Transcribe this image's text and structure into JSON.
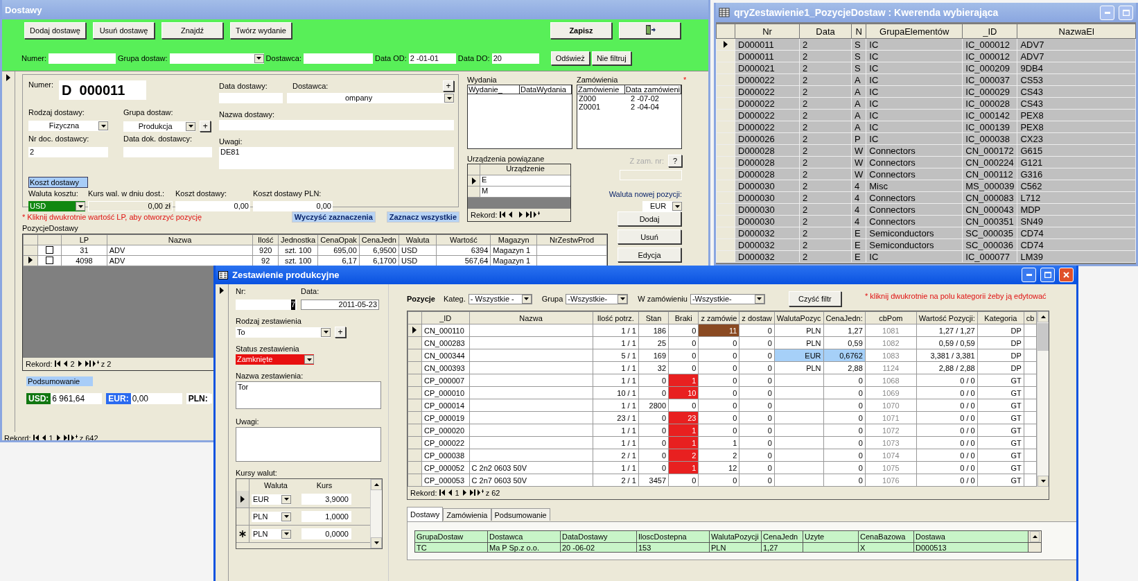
{
  "dostawy": {
    "title": "Dostawy",
    "toolbar": [
      "Dodaj dostawę",
      "Usuń dostawę",
      "Znajdź",
      "Twórz wydanie"
    ],
    "save": "Zapisz",
    "filter": {
      "numer_label": "Numer:",
      "grupa_label": "Grupa dostaw:",
      "dostawca_label": "Dostawca:",
      "od_label": "Data OD:",
      "od_value": "2 -01-01",
      "do_label": "Data DO:",
      "do_value": "20",
      "refresh": "Odśwież",
      "nofilter": "Nie filtruj"
    },
    "form": {
      "numer_label": "Numer:",
      "numer": "D  000011",
      "data_label": "Data dostawy:",
      "dostawca_label": "Dostawca:",
      "dostawca": "ompany",
      "plus": "+",
      "rodzaj_label": "Rodzaj dostawy:",
      "rodzaj": "Fizyczna",
      "grupa_label": "Grupa dostaw:",
      "grupa": "Produkcja",
      "grupa_plus": "+",
      "nazwa_label": "Nazwa dostawy:",
      "nrdoc_label": "Nr doc. dostawcy:",
      "nrdoc": "2",
      "datadok_label": "Data dok. dostawcy:",
      "uwagi_label": "Uwagi:",
      "uwagi": "DE81",
      "koszt_header": "Koszt dostawy",
      "waluta_label": "Waluta kosztu:",
      "waluta": "USD",
      "kurs_label": "Kurs wal. w dniu dost.:",
      "kurs": "0,00 zł",
      "koszt_label": "Koszt dostawy:",
      "koszt": "0,00",
      "kosztpln_label": "Koszt dostawy PLN:",
      "kosztpln": "0,00"
    },
    "note": "* Kliknij dwukrotnie wartość LP, aby otworzyć pozycję",
    "subform_label": "PozycjeDostawy",
    "clear_button": "Wyczyść zaznaczenia",
    "all_button": "Zaznacz wszystkie",
    "positions": {
      "columns": [
        "LP",
        "Nazwa",
        "Ilość",
        "Jednostka",
        "CenaOpak",
        "CenaJedn",
        "Waluta",
        "Wartość",
        "Magazyn",
        "NrZestwProd"
      ],
      "rows": [
        {
          "selected": false,
          "checked": false,
          "cells": [
            "31",
            "ADV",
            "920",
            "szt. 100",
            "695,00",
            "6,9500",
            "USD",
            "6394",
            "Magazyn 1"
          ]
        },
        {
          "selected": true,
          "checked": false,
          "cells": [
            "4098",
            "ADV",
            "92",
            "szt. 100",
            "6,17",
            "6,1700",
            "USD",
            "567,64",
            "Magazyn 1"
          ]
        }
      ],
      "nav": {
        "label": "Rekord:",
        "value": "2",
        "total": "z  2"
      }
    },
    "summary": {
      "header": "Podsumowanie",
      "usd_label": "USD:",
      "usd": "6 961,64",
      "eur_label": "EUR:",
      "eur": "0,00",
      "pln_label": "PLN:"
    },
    "wydania": {
      "title": "Wydania",
      "columns": [
        "Wydanie_",
        "DataWydania"
      ]
    },
    "zamowienia": {
      "title": "Zamówienia",
      "columns": [
        "Zamówienie",
        "Data zamówieni"
      ],
      "rows": [
        [
          "Z000",
          "2 -07-02"
        ],
        [
          "Z0001",
          "2 -04-04"
        ]
      ],
      "asterisk": "*"
    },
    "urzadzenia": {
      "title": "Urządzenia powiązane",
      "column": "Urządzenie",
      "rows": [
        {
          "text": "E",
          "selected": true
        },
        {
          "text": "M",
          "selected": false
        }
      ],
      "nav": {
        "label": "Rekord:"
      }
    },
    "zzam_label": "Z zam. nr:",
    "help_button": "?",
    "waluta_label": "Waluta nowej pozycji:",
    "waluta": "EUR",
    "buttons": [
      "Dodaj",
      "Usuń",
      "Edycja"
    ],
    "nav": {
      "label": "Rekord:",
      "value": "1",
      "total": "z  642"
    }
  },
  "query": {
    "title": "qryZestawienie1_PozycjeDostaw : Kwerenda wybierająca",
    "columns": [
      "Nr",
      "Data",
      "N",
      "GrupaElementów",
      "_ID",
      "NazwaEl"
    ],
    "rows": [
      {
        "selected": true,
        "cells": [
          "D000011",
          "2",
          "S",
          "IC",
          "IC_000012",
          "ADV7"
        ]
      },
      {
        "selected": false,
        "cells": [
          "D000011",
          "2",
          "S",
          "IC",
          "IC_000012",
          "ADV7"
        ]
      },
      {
        "selected": false,
        "cells": [
          "D000021",
          "2",
          "S",
          "IC",
          "IC_000209",
          "9DB4"
        ]
      },
      {
        "selected": false,
        "cells": [
          "D000022",
          "2",
          "A",
          "IC",
          "IC_000037",
          "CS53"
        ]
      },
      {
        "selected": false,
        "cells": [
          "D000022",
          "2",
          "A",
          "IC",
          "IC_000029",
          "CS43"
        ]
      },
      {
        "selected": false,
        "cells": [
          "D000022",
          "2",
          "A",
          "IC",
          "IC_000028",
          "CS43"
        ]
      },
      {
        "selected": false,
        "cells": [
          "D000022",
          "2",
          "A",
          "IC",
          "IC_000142",
          "PEX8"
        ]
      },
      {
        "selected": false,
        "cells": [
          "D000022",
          "2",
          "A",
          "IC",
          "IC_000139",
          "PEX8"
        ]
      },
      {
        "selected": false,
        "cells": [
          "D000026",
          "2",
          "P",
          "IC",
          "IC_000038",
          "CX23"
        ]
      },
      {
        "selected": false,
        "cells": [
          "D000028",
          "2",
          "W",
          "Connectors",
          "CN_000172",
          "G615"
        ]
      },
      {
        "selected": false,
        "cells": [
          "D000028",
          "2",
          "W",
          "Connectors",
          "CN_000224",
          "G121"
        ]
      },
      {
        "selected": false,
        "cells": [
          "D000028",
          "2",
          "W",
          "Connectors",
          "CN_000112",
          "G316"
        ]
      },
      {
        "selected": false,
        "cells": [
          "D000030",
          "2",
          "4",
          "Misc",
          "MS_000039",
          "C562"
        ]
      },
      {
        "selected": false,
        "cells": [
          "D000030",
          "2",
          "4",
          "Connectors",
          "CN_000083",
          "L712"
        ]
      },
      {
        "selected": false,
        "cells": [
          "D000030",
          "2",
          "4",
          "Connectors",
          "CN_000043",
          "MDP"
        ]
      },
      {
        "selected": false,
        "cells": [
          "D000030",
          "2",
          "4",
          "Connectors",
          "CN_000351",
          "SN49"
        ]
      },
      {
        "selected": false,
        "cells": [
          "D000032",
          "2",
          "E",
          "Semiconductors",
          "SC_000035",
          "CD74"
        ]
      },
      {
        "selected": false,
        "cells": [
          "D000032",
          "2",
          "E",
          "Semiconductors",
          "SC_000036",
          "CD74"
        ]
      },
      {
        "selected": false,
        "cells": [
          "D000032",
          "2",
          "E",
          "IC",
          "IC_000077",
          "LM39"
        ]
      }
    ]
  },
  "zestawienie": {
    "title": "Zestawienie produkcyjne",
    "left": {
      "nr_label": "Nr:",
      "nr": "7",
      "data_label": "Data:",
      "data": "2011-05-23",
      "rodzaj_label": "Rodzaj zestawienia",
      "rodzaj": "To",
      "plus": "+",
      "status_label": "Status zestawienia",
      "status": "Zamknięte",
      "nazwa_label": "Nazwa zestawienia:",
      "nazwa": "Tor",
      "uwagi_label": "Uwagi:",
      "kursy_label": "Kursy walut:",
      "kursy": {
        "columns": [
          "Waluta",
          "Kurs"
        ],
        "rows": [
          {
            "selected": true,
            "new": false,
            "waluta": "EUR",
            "kurs": "3,9000"
          },
          {
            "selected": false,
            "new": false,
            "waluta": "PLN",
            "kurs": "1,0000"
          },
          {
            "selected": false,
            "new": true,
            "waluta": "PLN",
            "kurs": "0,0000"
          }
        ]
      }
    },
    "filter": {
      "title": "Pozycje",
      "kateg_label": "Kateg.",
      "kateg": "- Wszystkie -",
      "grupa_label": "Grupa",
      "grupa": "-Wszystkie-",
      "zam_label": "W zamówieniu",
      "zam": "-Wszystkie-",
      "clear": "Czyść filtr",
      "note": "* kliknij dwukrotnie na polu kategorii żeby ją edytować"
    },
    "table": {
      "columns": [
        "_ID",
        "Nazwa",
        "Ilość potrz.",
        "Stan",
        "Braki",
        "z zamówie",
        "z dostaw",
        "WalutaPozyc",
        "CenaJedn:",
        "cbPom",
        "Wartość Pozycji:",
        "Kategoria",
        "cb"
      ],
      "rows": [
        {
          "selected": true,
          "braki_alert": false,
          "zam_alert": true,
          "currency_alert": false,
          "id": "CN_000110",
          "qty": "1 / 1",
          "stan": "186",
          "braki": "0",
          "zam": "11",
          "dost": "0",
          "waluta": "PLN",
          "cena": "1,27",
          "cbpom": "1081",
          "wartosc": "1,27 / 1,27",
          "kat": "DP"
        },
        {
          "selected": false,
          "braki_alert": false,
          "zam_alert": false,
          "currency_alert": false,
          "id": "CN_000283",
          "qty": "1 / 1",
          "stan": "25",
          "braki": "0",
          "zam": "0",
          "dost": "0",
          "waluta": "PLN",
          "cena": "0,59",
          "cbpom": "1082",
          "wartosc": "0,59 / 0,59",
          "kat": "DP"
        },
        {
          "selected": false,
          "braki_alert": false,
          "zam_alert": false,
          "currency_alert": true,
          "id": "CN_000344",
          "qty": "5 / 1",
          "stan": "169",
          "braki": "0",
          "zam": "0",
          "dost": "0",
          "waluta": "EUR",
          "cena": "0,6762",
          "cbpom": "1083",
          "wartosc": "3,381 / 3,381",
          "kat": "DP"
        },
        {
          "selected": false,
          "braki_alert": false,
          "zam_alert": false,
          "currency_alert": false,
          "id": "CN_000393",
          "qty": "1 / 1",
          "stan": "32",
          "braki": "0",
          "zam": "0",
          "dost": "0",
          "waluta": "PLN",
          "cena": "2,88",
          "cbpom": "1124",
          "wartosc": "2,88 / 2,88",
          "kat": "DP"
        },
        {
          "selected": false,
          "braki_alert": true,
          "zam_alert": false,
          "currency_alert": false,
          "id": "CP_000007",
          "qty": "1 / 1",
          "stan": "0",
          "braki": "1",
          "zam": "0",
          "dost": "0",
          "cena": "0",
          "cbpom": "1068",
          "wartosc": "0 / 0",
          "kat": "GT"
        },
        {
          "selected": false,
          "braki_alert": true,
          "zam_alert": false,
          "currency_alert": false,
          "id": "CP_000010",
          "qty": "10 / 1",
          "stan": "0",
          "braki": "10",
          "zam": "0",
          "dost": "0",
          "cena": "0",
          "cbpom": "1069",
          "wartosc": "0 / 0",
          "kat": "GT"
        },
        {
          "selected": false,
          "braki_alert": false,
          "zam_alert": false,
          "currency_alert": false,
          "id": "CP_000014",
          "qty": "1 / 1",
          "stan": "2800",
          "braki": "0",
          "zam": "0",
          "dost": "0",
          "cena": "0",
          "cbpom": "1070",
          "wartosc": "0 / 0",
          "kat": "GT"
        },
        {
          "selected": false,
          "braki_alert": true,
          "zam_alert": false,
          "currency_alert": false,
          "id": "CP_000019",
          "qty": "23 / 1",
          "stan": "0",
          "braki": "23",
          "zam": "0",
          "dost": "0",
          "cena": "0",
          "cbpom": "1071",
          "wartosc": "0 / 0",
          "kat": "GT"
        },
        {
          "selected": false,
          "braki_alert": true,
          "zam_alert": false,
          "currency_alert": false,
          "id": "CP_000020",
          "qty": "1 / 1",
          "stan": "0",
          "braki": "1",
          "zam": "0",
          "dost": "0",
          "cena": "0",
          "cbpom": "1072",
          "wartosc": "0 / 0",
          "kat": "GT"
        },
        {
          "selected": false,
          "braki_alert": true,
          "zam_alert": false,
          "currency_alert": false,
          "id": "CP_000022",
          "qty": "1 / 1",
          "stan": "0",
          "braki": "1",
          "zam": "1",
          "dost": "0",
          "cena": "0",
          "cbpom": "1073",
          "wartosc": "0 / 0",
          "kat": "GT"
        },
        {
          "selected": false,
          "braki_alert": true,
          "zam_alert": false,
          "currency_alert": false,
          "id": "CP_000038",
          "qty": "2 / 1",
          "stan": "0",
          "braki": "2",
          "zam": "2",
          "dost": "0",
          "cena": "0",
          "cbpom": "1074",
          "wartosc": "0 / 0",
          "kat": "GT"
        },
        {
          "selected": false,
          "braki_alert": true,
          "zam_alert": false,
          "currency_alert": false,
          "id": "CP_000052",
          "name": "C 2n2 0603 50V",
          "qty": "1 / 1",
          "stan": "0",
          "braki": "1",
          "zam": "12",
          "dost": "0",
          "cena": "0",
          "cbpom": "1075",
          "wartosc": "0 / 0",
          "kat": "GT"
        },
        {
          "selected": false,
          "braki_alert": false,
          "zam_alert": false,
          "currency_alert": false,
          "id": "CP_000053",
          "name": "C 2n7 0603 50V",
          "qty": "2 / 1",
          "stan": "3457",
          "braki": "0",
          "zam": "0",
          "dost": "0",
          "cena": "0",
          "cbpom": "1076",
          "wartosc": "0 / 0",
          "kat": "GT"
        }
      ],
      "nav": {
        "label": "Rekord:",
        "value": "1",
        "total": "z  62"
      }
    },
    "tabs": [
      {
        "label": "Dostawy",
        "selected": true
      },
      {
        "label": "Zamówienia",
        "selected": false
      },
      {
        "label": "Podsumowanie",
        "selected": false
      }
    ],
    "tab_table": {
      "columns": [
        "GrupaDostaw",
        "Dostawca",
        "DataDostawy",
        "IloscDostepna",
        "WalutaPozycji",
        "CenaJedn",
        "Uzyte",
        "CenaBazowa",
        "Dostawa"
      ],
      "rows": [
        [
          "TC",
          "Ma      P Sp.z o.o.",
          "20  -06-02",
          "153",
          "PLN",
          "1,27",
          null,
          "X",
          "D000513"
        ]
      ]
    }
  }
}
